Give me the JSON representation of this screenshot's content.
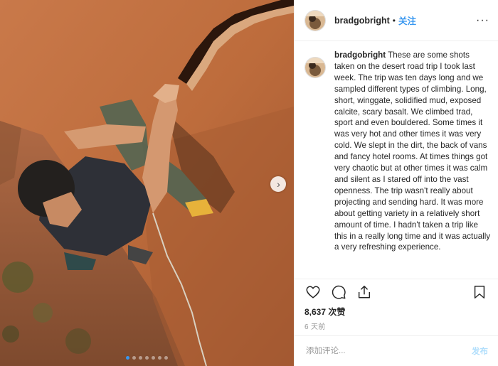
{
  "post": {
    "username": "bradgobright",
    "separator": "•",
    "follow_label": "关注",
    "more_label": "···",
    "caption_text": "These are some shots taken on the desert road trip I took last week. The trip was ten days long and we sampled different types of climbing. Long, short, winggate, solidified mud, exposed calcite, scary basalt. We climbed trad, sport and even bouldered. Some times it was very hot and other times it was very cold. We slept in the dirt, the back of vans and fancy hotel rooms. At times things got very chaotic but at other times it was calm and silent as I stared off into the vast openness. The trip wasn't really about projecting and sending hard. It was more about getting variety in a relatively short amount of time. I hadn't taken a trip like this in a really long time and it was actually a very refreshing experience.",
    "likes": "8,637 次赞",
    "time_ago": "6 天前",
    "comment_placeholder": "添加评论...",
    "post_button": "发布",
    "carousel": {
      "total": 7,
      "active": 0
    }
  },
  "icons": {
    "next": "chevron-right-icon",
    "like": "heart-icon",
    "comment": "comment-icon",
    "share": "share-icon",
    "save": "bookmark-icon"
  },
  "colors": {
    "accent": "#3897f0",
    "post_disabled": "#b2dffc",
    "muted": "#999999"
  }
}
